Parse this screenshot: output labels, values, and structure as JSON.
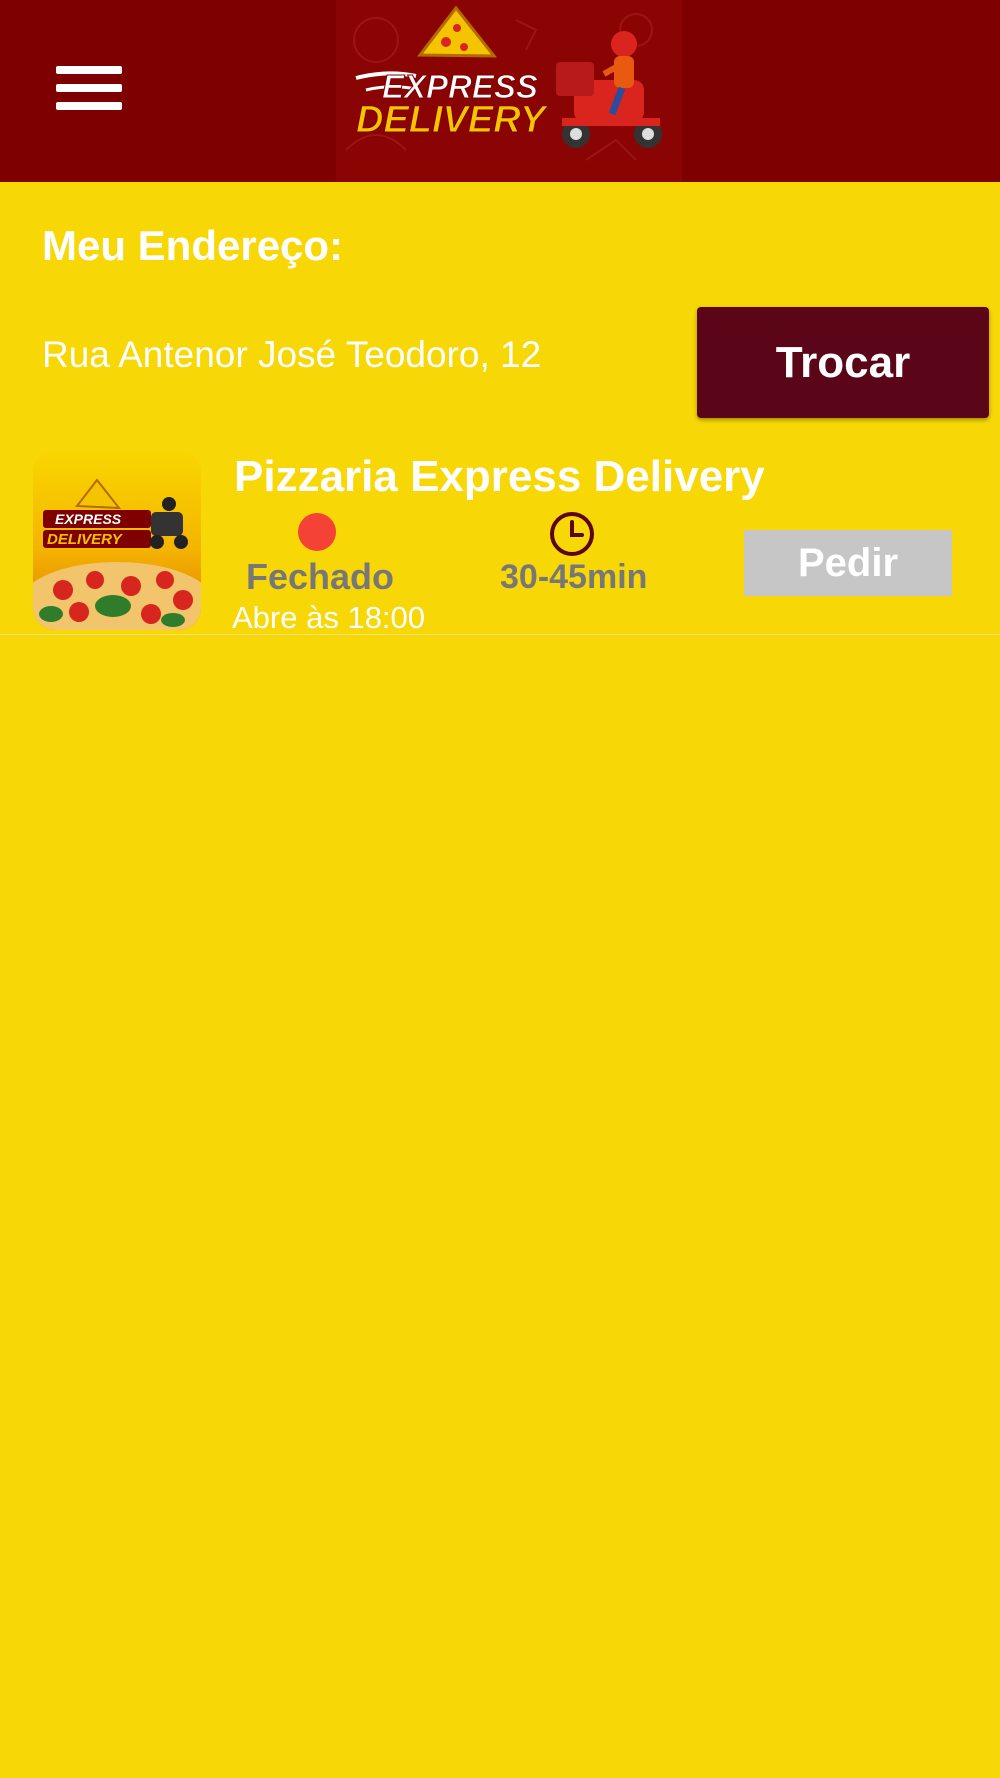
{
  "header": {
    "logo_text_line1": "EXPRESS",
    "logo_text_line2": "DELIVERY",
    "menu_icon": "hamburger-menu-icon",
    "colors": {
      "background": "#7E0000",
      "logo_accent": "#F5C400"
    }
  },
  "address": {
    "title": "Meu Endereço:",
    "value": "Rua Antenor José Teodoro, 12",
    "change_label": "Trocar"
  },
  "stores": [
    {
      "name": "Pizzaria Express Delivery",
      "status": "Fechado",
      "opens_at": "Abre às 18:00",
      "delivery_time": "30-45min",
      "order_label": "Pedir",
      "status_color": "#F44336"
    }
  ],
  "colors": {
    "page_background": "#F8D706",
    "button_primary": "#5A0518",
    "button_disabled": "#C6C6C6"
  }
}
